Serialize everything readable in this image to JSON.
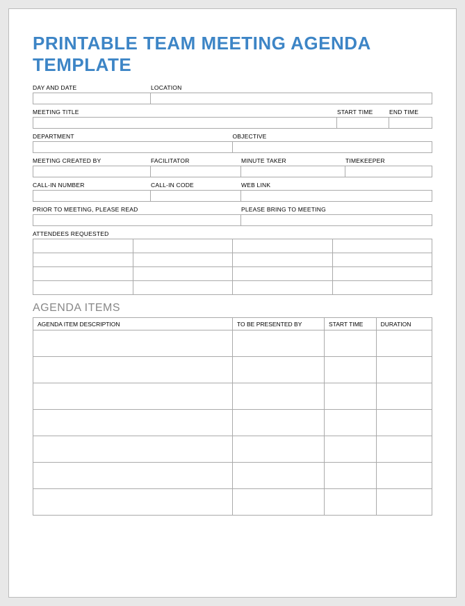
{
  "title": "PRINTABLE TEAM MEETING AGENDA TEMPLATE",
  "labels": {
    "day_date": "DAY AND DATE",
    "location": "LOCATION",
    "meeting_title": "MEETING TITLE",
    "start_time": "START TIME",
    "end_time": "END TIME",
    "department": "DEPARTMENT",
    "objective": "OBJECTIVE",
    "created_by": "MEETING CREATED BY",
    "facilitator": "FACILITATOR",
    "minute_taker": "MINUTE TAKER",
    "timekeeper": "TIMEKEEPER",
    "call_in_number": "CALL-IN NUMBER",
    "call_in_code": "CALL-IN CODE",
    "web_link": "WEB LINK",
    "prior_read": "PRIOR TO MEETING, PLEASE READ",
    "please_bring": "PLEASE BRING TO MEETING",
    "attendees": "ATTENDEES REQUESTED"
  },
  "fields": {
    "day_date": "",
    "location": "",
    "meeting_title": "",
    "start_time": "",
    "end_time": "",
    "department": "",
    "objective": "",
    "created_by": "",
    "facilitator": "",
    "minute_taker": "",
    "timekeeper": "",
    "call_in_number": "",
    "call_in_code": "",
    "web_link": "",
    "prior_read": "",
    "please_bring": ""
  },
  "attendees_rows": 4,
  "attendees_cols": 4,
  "agenda": {
    "heading": "AGENDA ITEMS",
    "columns": {
      "description": "AGENDA ITEM DESCRIPTION",
      "presented_by": "TO BE PRESENTED BY",
      "start_time": "START TIME",
      "duration": "DURATION"
    },
    "rows": 7
  },
  "chart_data": {
    "type": "table",
    "title": "AGENDA ITEMS",
    "columns": [
      "AGENDA ITEM DESCRIPTION",
      "TO BE PRESENTED BY",
      "START TIME",
      "DURATION"
    ],
    "rows": [
      [
        "",
        "",
        "",
        ""
      ],
      [
        "",
        "",
        "",
        ""
      ],
      [
        "",
        "",
        "",
        ""
      ],
      [
        "",
        "",
        "",
        ""
      ],
      [
        "",
        "",
        "",
        ""
      ],
      [
        "",
        "",
        "",
        ""
      ],
      [
        "",
        "",
        "",
        ""
      ]
    ]
  }
}
